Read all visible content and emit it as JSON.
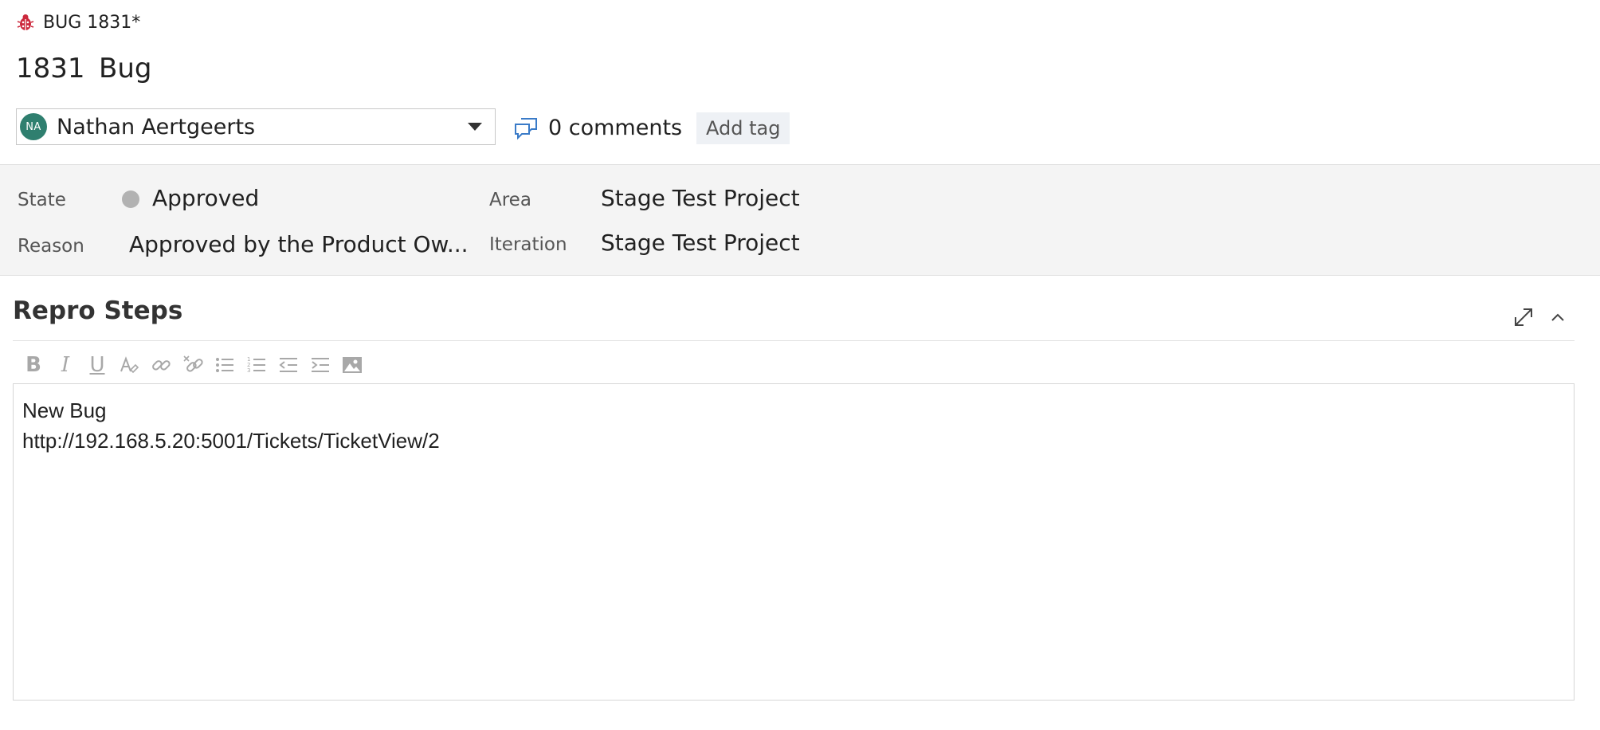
{
  "tab": {
    "title": "BUG 1831*",
    "icon": "bug-icon"
  },
  "work_item": {
    "id": "1831",
    "type": "Bug"
  },
  "assignee": {
    "initials": "NA",
    "name": "Nathan Aertgeerts"
  },
  "comments": {
    "label": "0 comments",
    "icon": "comments-icon"
  },
  "tags": {
    "add_label": "Add tag"
  },
  "fields": {
    "state": {
      "label": "State",
      "value": "Approved",
      "dot_color": "#b2b2b2"
    },
    "reason": {
      "label": "Reason",
      "value": "Approved by the Product Ow..."
    },
    "area": {
      "label": "Area",
      "value": "Stage Test Project"
    },
    "iteration": {
      "label": "Iteration",
      "value": "Stage Test Project"
    }
  },
  "repro_steps": {
    "title": "Repro Steps",
    "toolbar": {
      "bold": "B",
      "italic": "I",
      "underline": "U"
    },
    "lines": [
      "New Bug",
      "http://192.168.5.20:5001/Tickets/TicketView/2"
    ]
  },
  "colors": {
    "accent_bug": "#cc293d",
    "avatar_bg": "#2f7f6f",
    "section_bg": "#f4f4f4"
  }
}
